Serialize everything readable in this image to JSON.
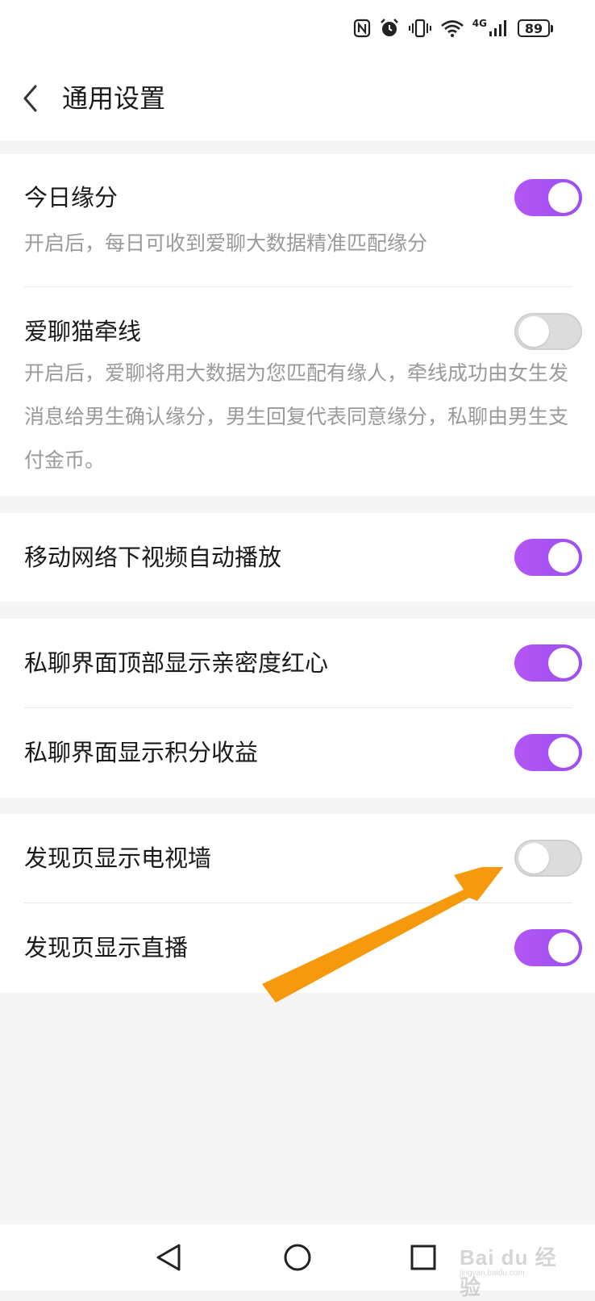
{
  "status_bar": {
    "battery": "89",
    "network": "4G",
    "icons": [
      "nfc-icon",
      "alarm-icon",
      "vibrate-icon",
      "wifi-icon",
      "signal-icon",
      "battery-icon"
    ]
  },
  "header": {
    "title": "通用设置",
    "back_icon": "chevron-left-icon"
  },
  "settings": {
    "today_match": {
      "title": "今日缘分",
      "description": "开启后，每日可收到爱聊大数据精准匹配缘分",
      "enabled": true
    },
    "matchmaker": {
      "title": "爱聊猫牵线",
      "description": "开启后，爱聊将用大数据为您匹配有缘人，牵线成功由女生发消息给男生确认缘分，男生回复代表同意缘分，私聊由男生支付金币。",
      "enabled": false
    },
    "autoplay_video": {
      "title": "移动网络下视频自动播放",
      "enabled": true
    },
    "intimacy_heart": {
      "title": "私聊界面顶部显示亲密度红心",
      "enabled": true
    },
    "points_income": {
      "title": "私聊界面显示积分收益",
      "enabled": true
    },
    "tv_wall": {
      "title": "发现页显示电视墙",
      "enabled": false
    },
    "live_stream": {
      "title": "发现页显示直播",
      "enabled": true
    }
  },
  "colors": {
    "toggle_on": "#a452f2",
    "toggle_off": "#dcdcdc",
    "annotation_arrow": "#f7990c",
    "page_background": "#f5f5f5"
  },
  "nav_bar": {
    "icons": [
      "back-triangle-icon",
      "home-circle-icon",
      "recents-square-icon"
    ]
  },
  "watermark": {
    "text": "Bai du 经验",
    "sub": "jingyan.baidu.com"
  }
}
